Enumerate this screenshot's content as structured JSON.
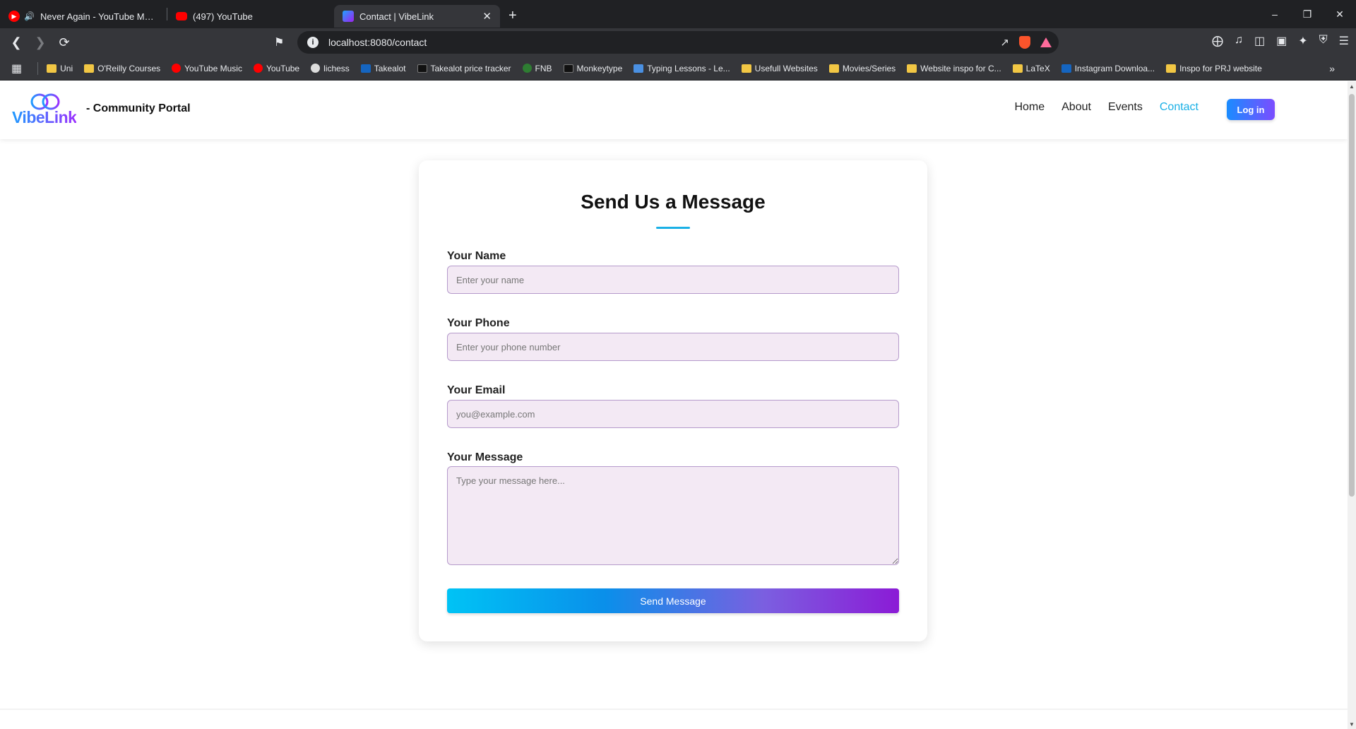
{
  "browser": {
    "tabs": [
      {
        "title": "Never Again - YouTube Music",
        "icon": "youtube-music-icon",
        "audio": true,
        "active": false
      },
      {
        "title": "(497) YouTube",
        "icon": "youtube-icon",
        "audio": false,
        "active": false
      },
      {
        "title": "Contact | VibeLink",
        "icon": "vibelink-icon",
        "audio": false,
        "active": true
      }
    ],
    "close_glyph": "✕",
    "new_tab_glyph": "+",
    "url": "localhost:8080/contact",
    "info_glyph": "i",
    "bookmarks": [
      {
        "label": "Uni",
        "icon": "folder"
      },
      {
        "label": "O'Reilly Courses",
        "icon": "folder"
      },
      {
        "label": "YouTube Music",
        "icon": "red"
      },
      {
        "label": "YouTube",
        "icon": "red"
      },
      {
        "label": "lichess",
        "icon": "white"
      },
      {
        "label": "Takealot",
        "icon": "blue"
      },
      {
        "label": "Takealot price tracker",
        "icon": "dark"
      },
      {
        "label": "FNB",
        "icon": "green"
      },
      {
        "label": "Monkeytype",
        "icon": "dark"
      },
      {
        "label": "Typing Lessons - Le...",
        "icon": "lightblue"
      },
      {
        "label": "Usefull Websites",
        "icon": "folder"
      },
      {
        "label": "Movies/Series",
        "icon": "folder"
      },
      {
        "label": "Website inspo for C...",
        "icon": "folder"
      },
      {
        "label": "LaTeX",
        "icon": "folder"
      },
      {
        "label": "Instagram Downloa...",
        "icon": "blue"
      },
      {
        "label": "Inspo for PRJ website",
        "icon": "folder"
      }
    ],
    "more_glyph": "»"
  },
  "site": {
    "logo_text": "VibeLink",
    "portal_title": "- Community Portal",
    "nav": [
      {
        "label": "Home",
        "active": false
      },
      {
        "label": "About",
        "active": false
      },
      {
        "label": "Events",
        "active": false
      },
      {
        "label": "Contact",
        "active": true
      }
    ],
    "login_label": "Log in",
    "accent_color": "#1ab0e6"
  },
  "form": {
    "heading": "Send Us a Message",
    "name_label": "Your Name",
    "name_placeholder": "Enter your name",
    "phone_label": "Your Phone",
    "phone_placeholder": "Enter your phone number",
    "email_label": "Your Email",
    "email_placeholder": "you@example.com",
    "message_label": "Your Message",
    "message_placeholder": "Type your message here...",
    "submit_label": "Send Message"
  }
}
